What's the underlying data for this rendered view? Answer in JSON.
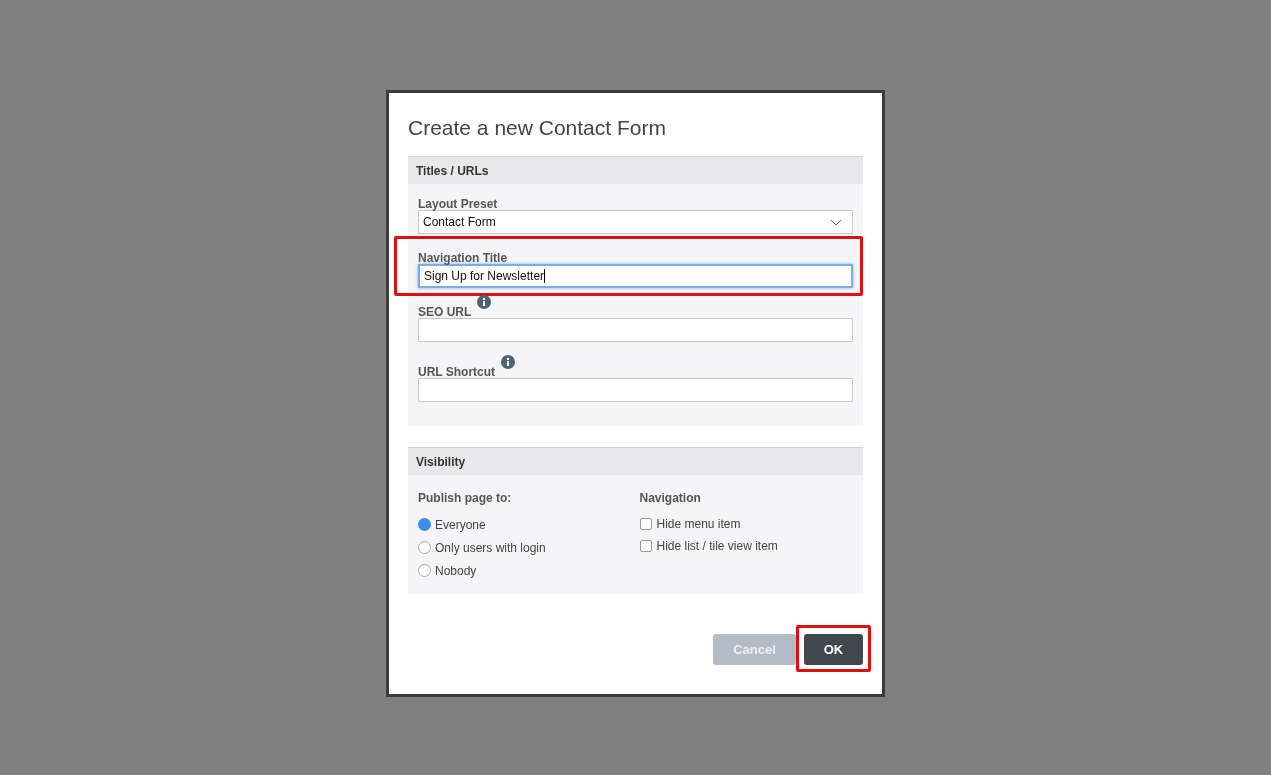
{
  "dialog": {
    "title": "Create a new Contact Form"
  },
  "sections": [
    {
      "title": "Titles / URLs",
      "fields": [
        {
          "kind": "select",
          "label": "Layout Preset",
          "value": "Contact Form"
        },
        {
          "kind": "text",
          "label": "Navigation Title",
          "value": "Sign Up for Newsletter",
          "focused": true,
          "highlighted": true
        },
        {
          "kind": "text",
          "label": "SEO URL",
          "info": true,
          "focused": false
        },
        {
          "kind": "text",
          "label": "URL Shortcut",
          "info": true,
          "focused": false
        }
      ]
    },
    {
      "title": "Visibility",
      "publish": {
        "label": "Publish page to:",
        "options": [
          {
            "label": "Everyone",
            "selected": true
          },
          {
            "label": "Only users with login",
            "selected": false
          },
          {
            "label": "Nobody",
            "selected": false
          }
        ]
      },
      "navigation": {
        "label": "Navigation",
        "options": [
          {
            "label": "Hide menu item",
            "checked": false
          },
          {
            "label": "Hide list / tile view item",
            "checked": false
          }
        ]
      }
    }
  ],
  "buttons": [
    {
      "label": "Cancel",
      "kind": "secondary"
    },
    {
      "label": "OK",
      "kind": "primary",
      "highlighted": true
    }
  ]
}
